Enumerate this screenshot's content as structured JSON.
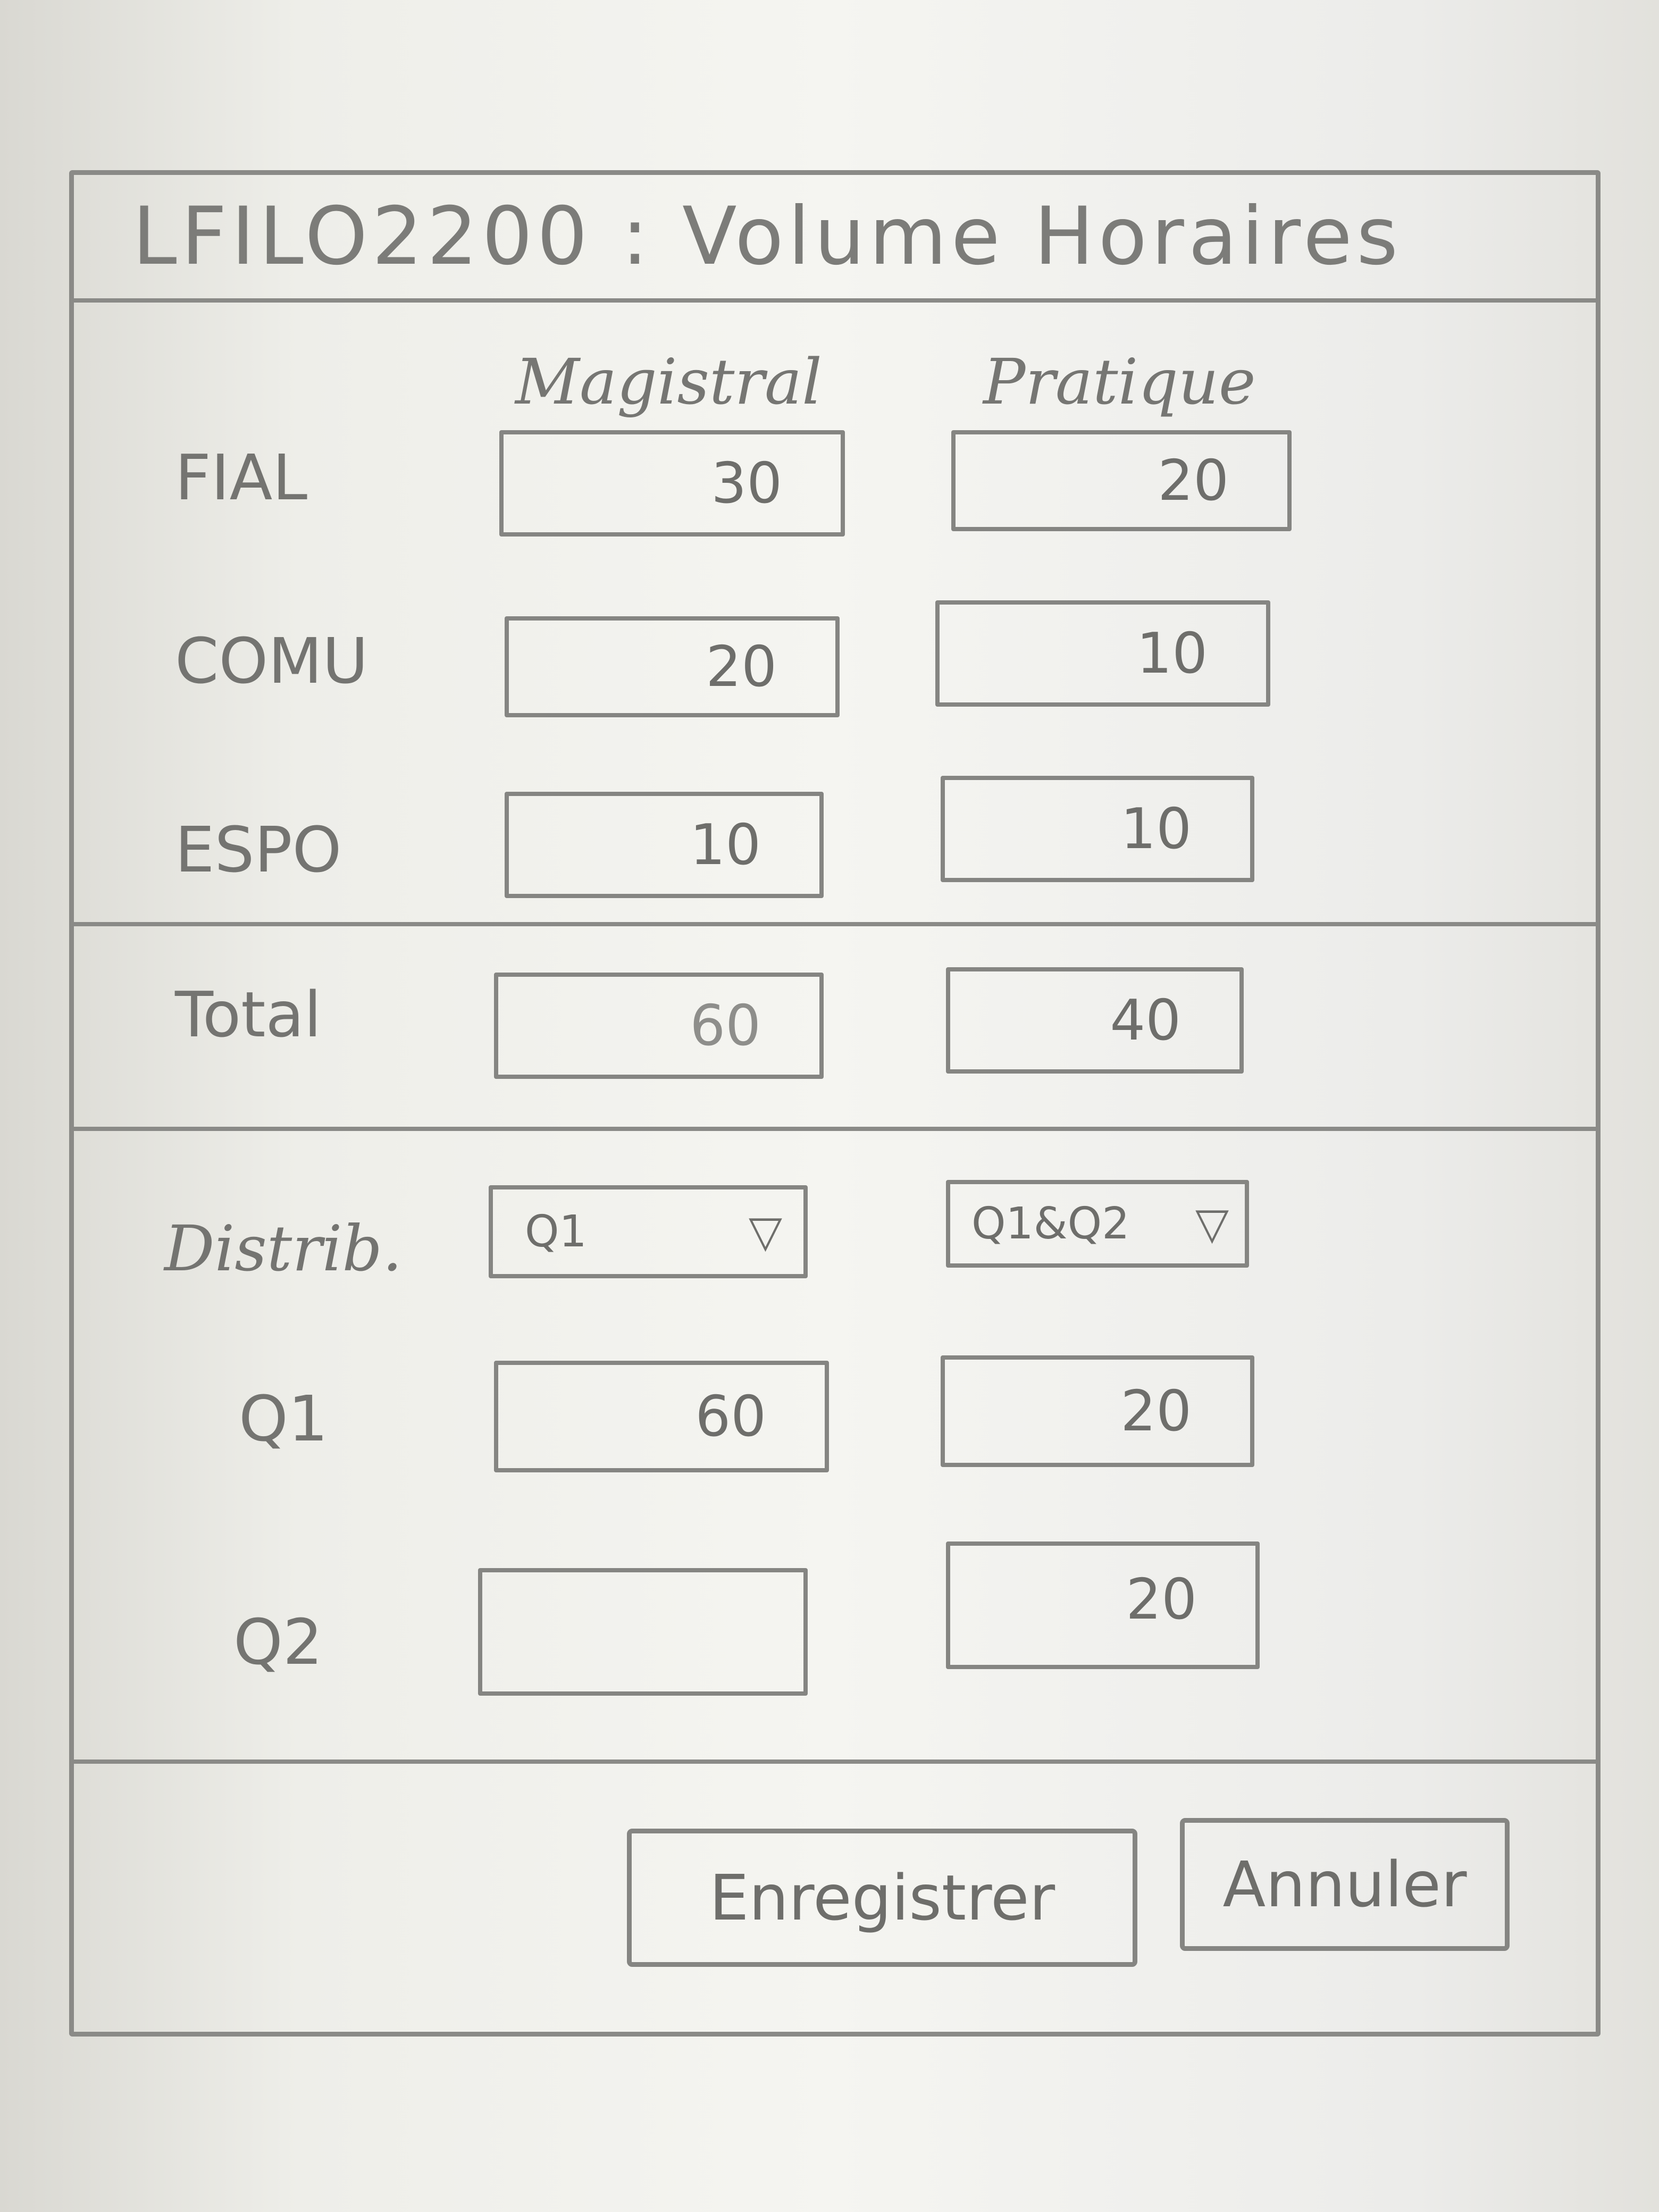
{
  "window": {
    "title": "LFILO2200 : Volume Horaires"
  },
  "columns": {
    "magistral": "Magistral",
    "pratique": "Pratique"
  },
  "rows": [
    {
      "label": "FIAL",
      "magistral": "30",
      "pratique": "20"
    },
    {
      "label": "COMU",
      "magistral": "20",
      "pratique": "10"
    },
    {
      "label": "ESPO",
      "magistral": "10",
      "pratique": "10"
    }
  ],
  "total": {
    "label": "Total",
    "magistral": "60",
    "pratique": "40"
  },
  "distribution": {
    "label": "Distrib.",
    "magistral_select": "Q1",
    "pratique_select": "Q1&Q2",
    "q1": {
      "label": "Q1",
      "magistral": "60",
      "pratique": "20"
    },
    "q2": {
      "label": "Q2",
      "magistral": "",
      "pratique": "20"
    }
  },
  "buttons": {
    "save": "Enregistrer",
    "cancel": "Annuler"
  }
}
